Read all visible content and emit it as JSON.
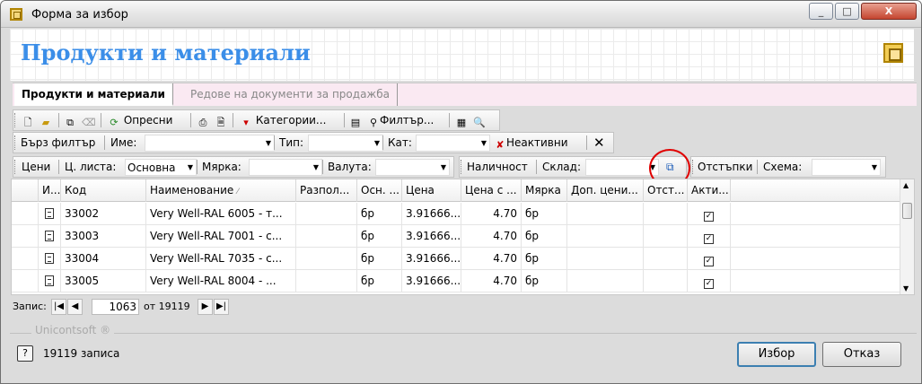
{
  "window": {
    "title": "Форма за избор",
    "minimize": "_",
    "maximize": "□",
    "close": "X"
  },
  "header": {
    "title": "Продукти и материали"
  },
  "tabs": [
    {
      "label": "Продукти и материали"
    },
    {
      "label": "Редове на документи за продажба"
    }
  ],
  "toolbar1": {
    "refresh": "Опресни",
    "categories": "Категории...",
    "filters": "Филтър..."
  },
  "toolbar2": {
    "quick_filter": "Бърз филтър",
    "name_label": "Име:",
    "name_value": "",
    "type_label": "Тип:",
    "type_value": "",
    "cat_label": "Кат:",
    "cat_value": "",
    "inactive": "Неактивни"
  },
  "toolbar3": {
    "prices": "Цени",
    "pricelist_label": "Ц. листа:",
    "pricelist_value": "Основна",
    "measure_label": "Мярка:",
    "measure_value": "",
    "currency_label": "Валута:",
    "currency_value": ""
  },
  "toolbar4": {
    "availability": "Наличност",
    "warehouse_label": "Склад:",
    "warehouse_value": ""
  },
  "toolbar5": {
    "discounts": "Отстъпки",
    "scheme_label": "Схема:",
    "scheme_value": ""
  },
  "grid": {
    "columns": [
      "И...",
      "Код",
      "Наименование",
      "Разпол...",
      "Осн. ...",
      "Цена",
      "Цена с ...",
      "Мярка",
      "Доп. цени...",
      "Отст...",
      "Акти..."
    ],
    "rows": [
      {
        "code": "33002",
        "name": "Very Well-RAL 6005 - т...",
        "avail": "",
        "base": "бр",
        "price": "3.91666...",
        "price_vat": "4.70",
        "unit": "бр",
        "add_price": "",
        "disc": "",
        "active": "✓"
      },
      {
        "code": "33003",
        "name": "Very Well-RAL 7001 - с...",
        "avail": "",
        "base": "бр",
        "price": "3.91666...",
        "price_vat": "4.70",
        "unit": "бр",
        "add_price": "",
        "disc": "",
        "active": "✓"
      },
      {
        "code": "33004",
        "name": "Very Well-RAL 7035 - с...",
        "avail": "",
        "base": "бр",
        "price": "3.91666...",
        "price_vat": "4.70",
        "unit": "бр",
        "add_price": "",
        "disc": "",
        "active": "✓"
      },
      {
        "code": "33005",
        "name": "Very Well-RAL 8004 - ...",
        "avail": "",
        "base": "бр",
        "price": "3.91666...",
        "price_vat": "4.70",
        "unit": "бр",
        "add_price": "",
        "disc": "",
        "active": "✓"
      }
    ]
  },
  "navigator": {
    "label": "Запис:",
    "current": "1063",
    "of": "от 19119"
  },
  "footer": {
    "brand": "Unicontsoft ®",
    "status": "19119 записа",
    "select": "Избор",
    "cancel": "Отказ"
  }
}
